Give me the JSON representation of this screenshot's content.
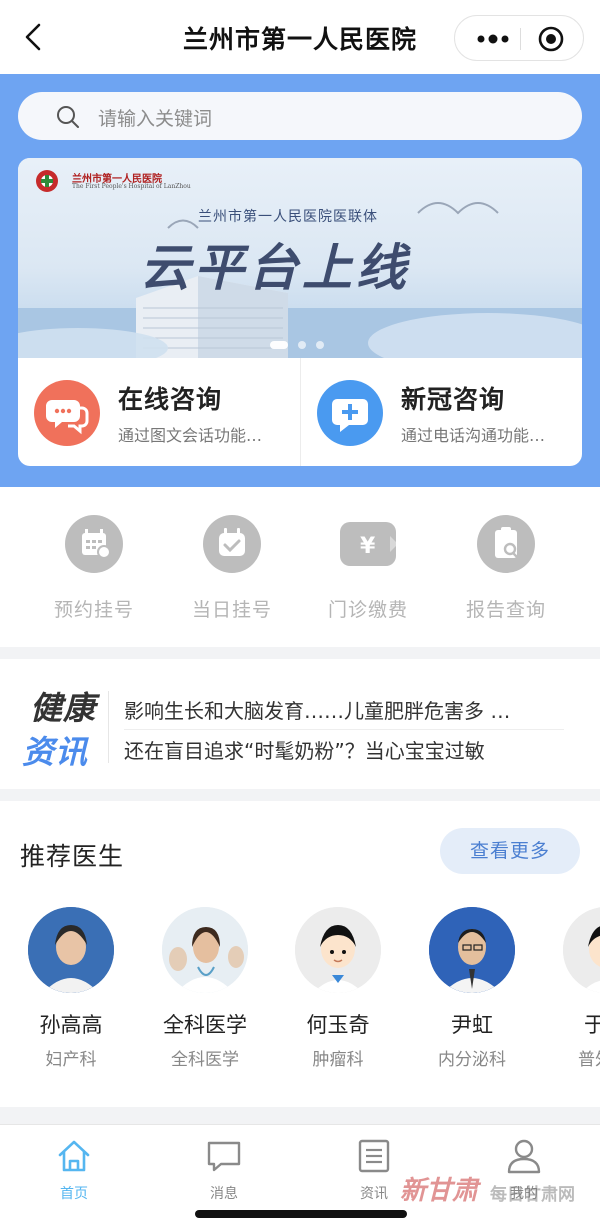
{
  "titlebar": {
    "title": "兰州市第一人民医院"
  },
  "search": {
    "placeholder": "请输入关键词"
  },
  "banner": {
    "logo_zh": "兰州市第一人民医院",
    "logo_en": "The First People's Hospital of LanZhou",
    "subtitle": "兰州市第一人民医院医联体",
    "headline": "云平台上线"
  },
  "consult": [
    {
      "title": "在线咨询",
      "desc": "通过图文会话功能…",
      "icon": "chat-bubbles-icon",
      "color": "#f0715b"
    },
    {
      "title": "新冠咨询",
      "desc": "通过电话沟通功能…",
      "icon": "medical-chat-icon",
      "color": "#4a9af0"
    }
  ],
  "services": [
    {
      "label": "预约挂号",
      "icon": "calendar-grid-icon"
    },
    {
      "label": "当日挂号",
      "icon": "calendar-check-icon"
    },
    {
      "label": "门诊缴费",
      "icon": "yen-ticket-icon"
    },
    {
      "label": "报告查询",
      "icon": "report-search-icon"
    }
  ],
  "news": {
    "logo_top": "健康",
    "logo_bottom": "资讯",
    "items": [
      "影响生长和大脑发育……儿童肥胖危害多 …",
      "还在盲目追求“时髦奶粉”？当心宝宝过敏"
    ]
  },
  "doctors": {
    "heading": "推荐医生",
    "more_label": "查看更多",
    "list": [
      {
        "name": "孙高高",
        "dept": "妇产科"
      },
      {
        "name": "全科医学",
        "dept": "全科医学"
      },
      {
        "name": "何玉奇",
        "dept": "肿瘤科"
      },
      {
        "name": "尹虹",
        "dept": "内分泌科"
      },
      {
        "name": "于",
        "dept": "普外"
      }
    ]
  },
  "tabbar": [
    {
      "label": "首页",
      "icon": "home-icon",
      "active": true
    },
    {
      "label": "消息",
      "icon": "message-icon",
      "active": false
    },
    {
      "label": "资讯",
      "icon": "news-list-icon",
      "active": false
    },
    {
      "label": "我的",
      "icon": "user-icon",
      "active": false
    }
  ],
  "watermark": {
    "brand": "新甘肃",
    "site": "每日甘肃网"
  },
  "colors": {
    "hero_blue": "#6ea4f2",
    "accent": "#55b6f0",
    "news_blue": "#4b8bec"
  }
}
